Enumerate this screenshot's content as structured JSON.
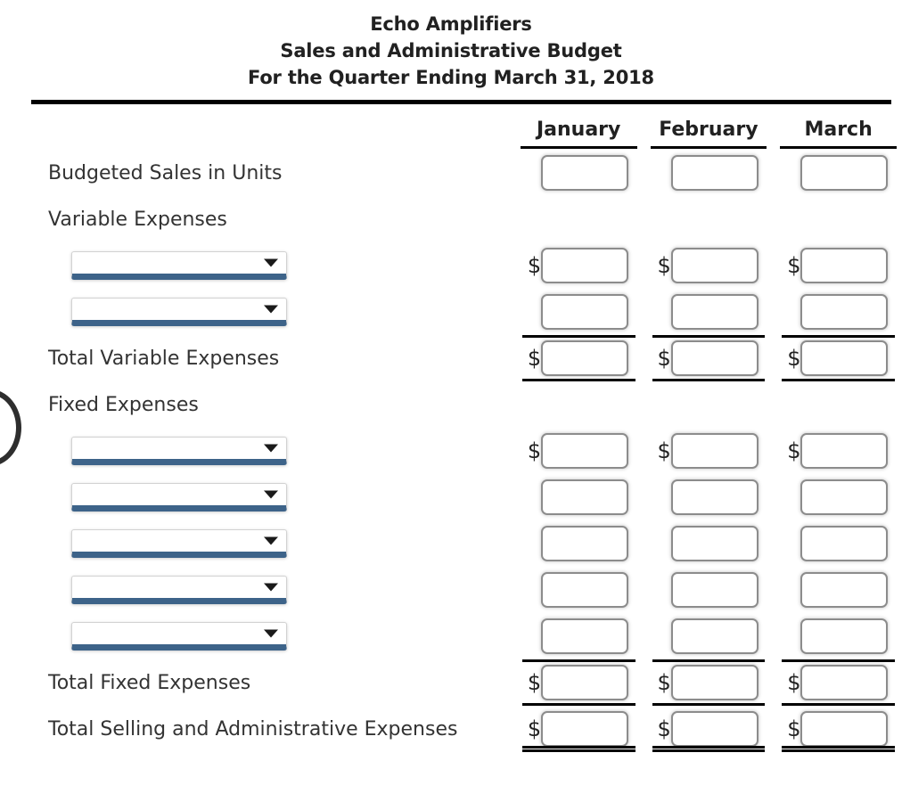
{
  "document": {
    "company": "Echo Amplifiers",
    "statement": "Sales and Administrative Budget",
    "period": "For the Quarter Ending March 31, 2018"
  },
  "columns": [
    {
      "label": "January"
    },
    {
      "label": "February"
    },
    {
      "label": "March"
    }
  ],
  "rows": [
    {
      "id": "budgeted-sales-units",
      "label": "Budgeted Sales in Units",
      "type": "input",
      "currency": false,
      "top_rule": false,
      "bottom_rule": false,
      "double_rule": false
    },
    {
      "id": "variable-expenses",
      "label": "Variable Expenses",
      "type": "section",
      "currency": false
    },
    {
      "id": "variable-expense-1",
      "label": "",
      "type": "select",
      "selected": "",
      "currency": true,
      "top_rule": false,
      "bottom_rule": false,
      "double_rule": false
    },
    {
      "id": "variable-expense-2",
      "label": "",
      "type": "select",
      "selected": "",
      "currency": false,
      "top_rule": false,
      "bottom_rule": false,
      "double_rule": false
    },
    {
      "id": "total-variable-expenses",
      "label": "Total Variable Expenses",
      "type": "input",
      "currency": true,
      "top_rule": true,
      "bottom_rule": true,
      "double_rule": false
    },
    {
      "id": "fixed-expenses",
      "label": "Fixed Expenses",
      "type": "section",
      "currency": false
    },
    {
      "id": "fixed-expense-1",
      "label": "",
      "type": "select",
      "selected": "",
      "currency": true,
      "top_rule": false,
      "bottom_rule": false,
      "double_rule": false
    },
    {
      "id": "fixed-expense-2",
      "label": "",
      "type": "select",
      "selected": "",
      "currency": false,
      "top_rule": false,
      "bottom_rule": false,
      "double_rule": false
    },
    {
      "id": "fixed-expense-3",
      "label": "",
      "type": "select",
      "selected": "",
      "currency": false,
      "top_rule": false,
      "bottom_rule": false,
      "double_rule": false
    },
    {
      "id": "fixed-expense-4",
      "label": "",
      "type": "select",
      "selected": "",
      "currency": false,
      "top_rule": false,
      "bottom_rule": false,
      "double_rule": false
    },
    {
      "id": "fixed-expense-5",
      "label": "",
      "type": "select",
      "selected": "",
      "currency": false,
      "top_rule": false,
      "bottom_rule": false,
      "double_rule": false
    },
    {
      "id": "total-fixed-expenses",
      "label": "Total Fixed Expenses",
      "type": "input",
      "currency": true,
      "top_rule": true,
      "bottom_rule": true,
      "double_rule": false
    },
    {
      "id": "total-selling-administrative-expenses",
      "label": "Total Selling and Administrative Expenses",
      "type": "input",
      "currency": true,
      "top_rule": false,
      "bottom_rule": false,
      "double_rule": true
    }
  ],
  "symbols": {
    "currency": "$",
    "dropdown_arrow": "chevron-down-icon"
  },
  "input_values": {
    "placeholder": "",
    "value": ""
  },
  "colors": {
    "rule": "#000000",
    "select_underline": "#3d6389",
    "input_border": "#8c8c8c",
    "text": "#333333"
  }
}
